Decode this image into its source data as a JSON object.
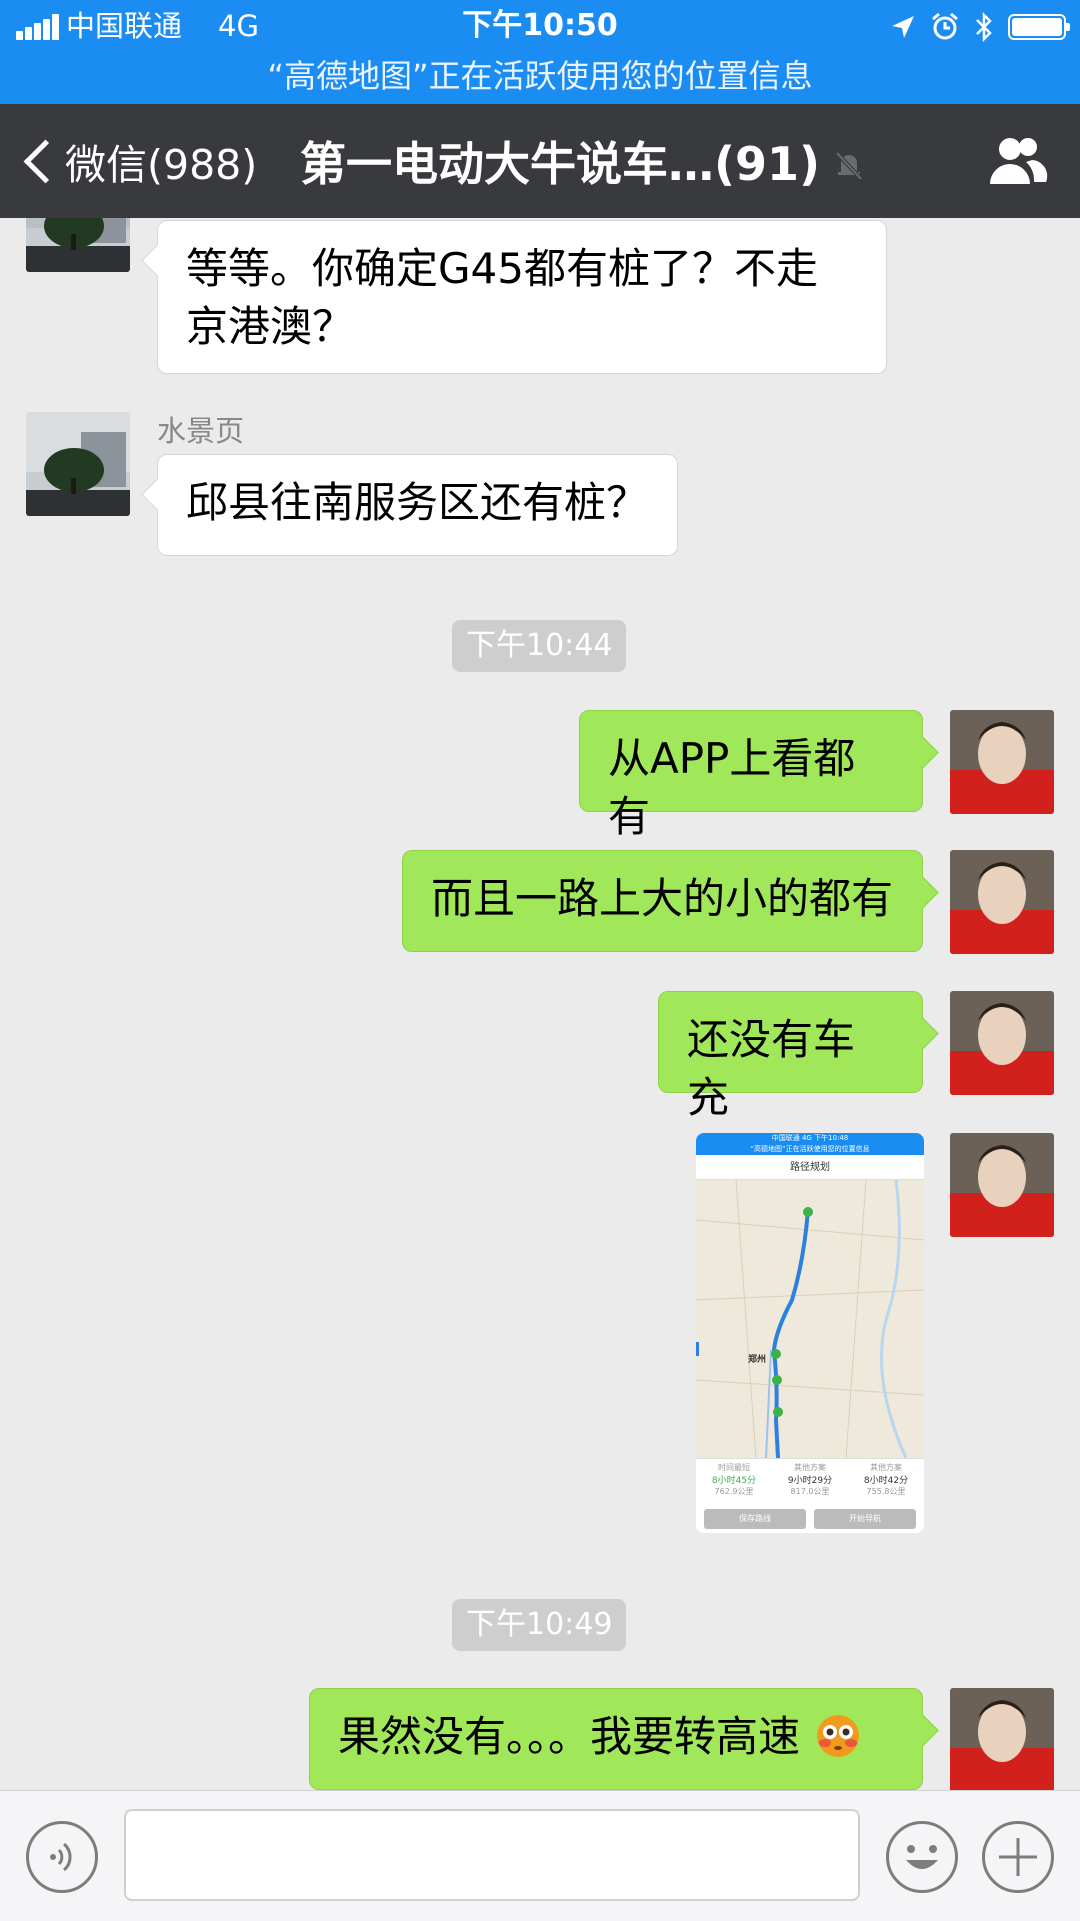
{
  "status_bar": {
    "carrier": "中国联通",
    "network": "4G",
    "time": "下午10:50",
    "location_banner": "“高德地图”正在活跃使用您的位置信息"
  },
  "nav": {
    "back_label": "微信(988)",
    "title": "第一电动大牛说车…(91)"
  },
  "messages": {
    "m1": {
      "text": "等等。你确定G45都有桩了？不走京港澳？"
    },
    "m2": {
      "sender": "水景页",
      "text": "邱县往南服务区还有桩？"
    },
    "ts1": "下午10:44",
    "m3": {
      "text": "从APP上看都有"
    },
    "m4": {
      "text": "而且一路上大的小的都有"
    },
    "m5": {
      "text": "还没有车充"
    },
    "m6_image": {
      "status": "中国联通 4G   下午10:48",
      "banner": "“高德地图”正在活跃使用您的位置信息",
      "title": "路径规划",
      "city": "郑州",
      "routes": [
        {
          "label": "时间最短",
          "time": "8小时45分",
          "dist": "762.9公里"
        },
        {
          "label": "其他方案",
          "time": "9小时29分",
          "dist": "817.0公里"
        },
        {
          "label": "其他方案",
          "time": "8小时42分",
          "dist": "755.8公里"
        }
      ],
      "btn_save": "保存路线",
      "btn_nav": "开始导航"
    },
    "ts2": "下午10:49",
    "m7": {
      "text": "果然没有。。。我要转高速"
    }
  },
  "input": {
    "placeholder": ""
  },
  "colors": {
    "status_bar": "#1a8cf2",
    "nav_bar": "#393a3e",
    "chat_bg": "#ebebeb",
    "outgoing_bubble": "#a0e75a",
    "incoming_bubble": "#ffffff"
  }
}
